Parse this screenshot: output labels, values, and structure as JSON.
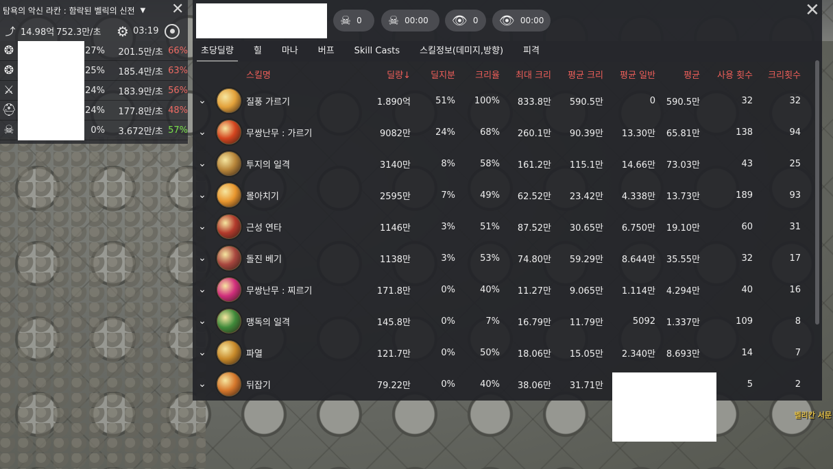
{
  "background": {
    "location_label": "벨리칸 서문"
  },
  "mini_panel": {
    "title": "탐욕의 악신 라칸 : 함락된 벨릭의 신전",
    "total_damage": "14.98억",
    "dps": "752.3만/초",
    "elapsed": "03:19",
    "players": [
      {
        "class_icon": "sun-wheel-icon",
        "share": "27%",
        "dps": "201.5만/초",
        "crit": "66%",
        "crit_color": "#ee6a63"
      },
      {
        "class_icon": "sun-wheel-icon",
        "share": "25%",
        "dps": "185.4만/초",
        "crit": "63%",
        "crit_color": "#ee6a63"
      },
      {
        "class_icon": "crossed-swords-icon",
        "share": "24%",
        "dps": "183.9만/초",
        "crit": "56%",
        "crit_color": "#ee6a63"
      },
      {
        "class_icon": "helmet-icon",
        "share": "24%",
        "dps": "177.8만/초",
        "crit": "48%",
        "crit_color": "#ee6a63"
      },
      {
        "class_icon": "skull-crossbones-icon",
        "share": "0%",
        "dps": "3.672만/초",
        "crit": "57%",
        "crit_color": "#79e04a"
      }
    ]
  },
  "header": {
    "deaths": "0",
    "death_time": "00:00",
    "views": "0",
    "view_time": "00:00"
  },
  "tabs": [
    "초당딜량",
    "힐",
    "마나",
    "버프",
    "Skill Casts",
    "스킬정보(데미지,방향)",
    "피격"
  ],
  "table": {
    "headers": {
      "name": "스킬명",
      "damage": "딜량↓",
      "share": "딜지분",
      "crit_rate": "크리율",
      "max_crit": "최대 크리",
      "avg_crit": "평균 크리",
      "avg_normal": "평균 일반",
      "avg": "평균",
      "uses": "사용 횟수",
      "crit_count": "크리횟수"
    },
    "rows": [
      {
        "name": "질풍 가르기",
        "damage": "1.890억",
        "share": "51%",
        "crit_rate": "100%",
        "max_crit": "833.8만",
        "avg_crit": "590.5만",
        "avg_normal": "0",
        "avg": "590.5만",
        "uses": "32",
        "crit_count": "32",
        "color": "#e3a13a"
      },
      {
        "name": "무쌍난무 : 가르기",
        "damage": "9082만",
        "share": "24%",
        "crit_rate": "68%",
        "max_crit": "260.1만",
        "avg_crit": "90.39만",
        "avg_normal": "13.30만",
        "avg": "65.81만",
        "uses": "138",
        "crit_count": "94",
        "color": "#d4451f"
      },
      {
        "name": "투지의 일격",
        "damage": "3140만",
        "share": "8%",
        "crit_rate": "58%",
        "max_crit": "161.2만",
        "avg_crit": "115.1만",
        "avg_normal": "14.66만",
        "avg": "73.03만",
        "uses": "43",
        "crit_count": "25",
        "color": "#b8863a"
      },
      {
        "name": "몰아치기",
        "damage": "2595만",
        "share": "7%",
        "crit_rate": "49%",
        "max_crit": "62.52만",
        "avg_crit": "23.42만",
        "avg_normal": "4.338만",
        "avg": "13.73만",
        "uses": "189",
        "crit_count": "93",
        "color": "#e8962e"
      },
      {
        "name": "근성 연타",
        "damage": "1146만",
        "share": "3%",
        "crit_rate": "51%",
        "max_crit": "87.52만",
        "avg_crit": "30.65만",
        "avg_normal": "6.750만",
        "avg": "19.10만",
        "uses": "60",
        "crit_count": "31",
        "color": "#b23a2c"
      },
      {
        "name": "돌진 베기",
        "damage": "1138만",
        "share": "3%",
        "crit_rate": "53%",
        "max_crit": "74.80만",
        "avg_crit": "59.29만",
        "avg_normal": "8.644만",
        "avg": "35.55만",
        "uses": "32",
        "crit_count": "17",
        "color": "#a8473f"
      },
      {
        "name": "무쌍난무 : 찌르기",
        "damage": "171.8만",
        "share": "0%",
        "crit_rate": "40%",
        "max_crit": "11.27만",
        "avg_crit": "9.065만",
        "avg_normal": "1.114만",
        "avg": "4.294만",
        "uses": "40",
        "crit_count": "16",
        "color": "#d02e7c"
      },
      {
        "name": "맹독의 일격",
        "damage": "145.8만",
        "share": "0%",
        "crit_rate": "7%",
        "max_crit": "16.79만",
        "avg_crit": "11.79만",
        "avg_normal": "5092",
        "avg": "1.337만",
        "uses": "109",
        "crit_count": "8",
        "color": "#3f8a3a"
      },
      {
        "name": "파열",
        "damage": "121.7만",
        "share": "0%",
        "crit_rate": "50%",
        "max_crit": "18.06만",
        "avg_crit": "15.05만",
        "avg_normal": "2.340만",
        "avg": "8.693만",
        "uses": "14",
        "crit_count": "7",
        "color": "#c88a2a"
      },
      {
        "name": "뒤잡기",
        "damage": "79.22만",
        "share": "0%",
        "crit_rate": "40%",
        "max_crit": "38.06만",
        "avg_crit": "31.71만",
        "avg_normal": "",
        "avg": "",
        "uses": "5",
        "crit_count": "2",
        "color": "#d6782c"
      }
    ]
  }
}
